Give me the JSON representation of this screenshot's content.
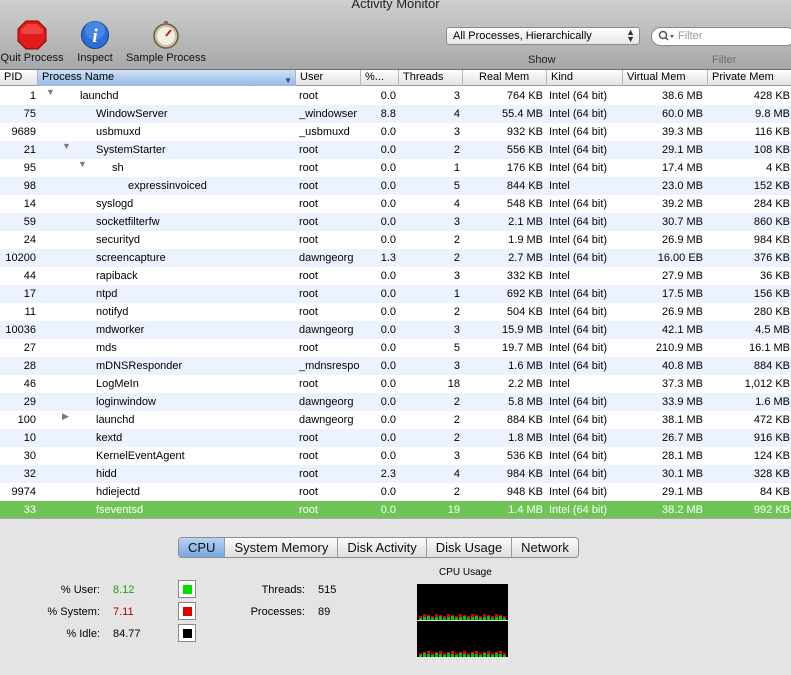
{
  "window": {
    "title": "Activity Monitor"
  },
  "toolbar": {
    "quit_label": "Quit Process",
    "inspect_label": "Inspect",
    "sample_label": "Sample Process",
    "show_value": "All Processes, Hierarchically",
    "show_label": "Show",
    "filter_placeholder": "Filter",
    "filter_label": "Filter"
  },
  "columns": {
    "pid": "PID",
    "name": "Process Name",
    "user": "User",
    "cpu": "%...",
    "threads": "Threads",
    "real_mem": "Real Mem",
    "kind": "Kind",
    "virtual_mem": "Virtual Mem",
    "private_mem": "Private Mem"
  },
  "processes": [
    {
      "pid": "1",
      "name": "launchd",
      "user": "root",
      "cpu": "0.0",
      "threads": "3",
      "real_mem": "764 KB",
      "kind": "Intel (64 bit)",
      "virtual_mem": "38.6 MB",
      "private_mem": "428 KB",
      "depth": 0,
      "toggle": "open"
    },
    {
      "pid": "75",
      "name": "WindowServer",
      "user": "_windowser",
      "cpu": "8.8",
      "threads": "4",
      "real_mem": "55.4 MB",
      "kind": "Intel (64 bit)",
      "virtual_mem": "60.0 MB",
      "private_mem": "9.8 MB",
      "depth": 1,
      "toggle": ""
    },
    {
      "pid": "9689",
      "name": "usbmuxd",
      "user": "_usbmuxd",
      "cpu": "0.0",
      "threads": "3",
      "real_mem": "932 KB",
      "kind": "Intel (64 bit)",
      "virtual_mem": "39.3 MB",
      "private_mem": "116 KB",
      "depth": 1,
      "toggle": ""
    },
    {
      "pid": "21",
      "name": "SystemStarter",
      "user": "root",
      "cpu": "0.0",
      "threads": "2",
      "real_mem": "556 KB",
      "kind": "Intel (64 bit)",
      "virtual_mem": "29.1 MB",
      "private_mem": "108 KB",
      "depth": 1,
      "toggle": "open"
    },
    {
      "pid": "95",
      "name": "sh",
      "user": "root",
      "cpu": "0.0",
      "threads": "1",
      "real_mem": "176 KB",
      "kind": "Intel (64 bit)",
      "virtual_mem": "17.4 MB",
      "private_mem": "4 KB",
      "depth": 2,
      "toggle": "open"
    },
    {
      "pid": "98",
      "name": "expressinvoiced",
      "user": "root",
      "cpu": "0.0",
      "threads": "5",
      "real_mem": "844 KB",
      "kind": "Intel",
      "virtual_mem": "23.0 MB",
      "private_mem": "152 KB",
      "depth": 3,
      "toggle": ""
    },
    {
      "pid": "14",
      "name": "syslogd",
      "user": "root",
      "cpu": "0.0",
      "threads": "4",
      "real_mem": "548 KB",
      "kind": "Intel (64 bit)",
      "virtual_mem": "39.2 MB",
      "private_mem": "284 KB",
      "depth": 1,
      "toggle": ""
    },
    {
      "pid": "59",
      "name": "socketfilterfw",
      "user": "root",
      "cpu": "0.0",
      "threads": "3",
      "real_mem": "2.1 MB",
      "kind": "Intel (64 bit)",
      "virtual_mem": "30.7 MB",
      "private_mem": "860 KB",
      "depth": 1,
      "toggle": ""
    },
    {
      "pid": "24",
      "name": "securityd",
      "user": "root",
      "cpu": "0.0",
      "threads": "2",
      "real_mem": "1.9 MB",
      "kind": "Intel (64 bit)",
      "virtual_mem": "26.9 MB",
      "private_mem": "984 KB",
      "depth": 1,
      "toggle": ""
    },
    {
      "pid": "10200",
      "name": "screencapture",
      "user": "dawngeorg",
      "cpu": "1.3",
      "threads": "2",
      "real_mem": "2.7 MB",
      "kind": "Intel (64 bit)",
      "virtual_mem": "16.00 EB",
      "private_mem": "376 KB",
      "depth": 1,
      "toggle": ""
    },
    {
      "pid": "44",
      "name": "rapiback",
      "user": "root",
      "cpu": "0.0",
      "threads": "3",
      "real_mem": "332 KB",
      "kind": "Intel",
      "virtual_mem": "27.9 MB",
      "private_mem": "36 KB",
      "depth": 1,
      "toggle": ""
    },
    {
      "pid": "17",
      "name": "ntpd",
      "user": "root",
      "cpu": "0.0",
      "threads": "1",
      "real_mem": "692 KB",
      "kind": "Intel (64 bit)",
      "virtual_mem": "17.5 MB",
      "private_mem": "156 KB",
      "depth": 1,
      "toggle": ""
    },
    {
      "pid": "11",
      "name": "notifyd",
      "user": "root",
      "cpu": "0.0",
      "threads": "2",
      "real_mem": "504 KB",
      "kind": "Intel (64 bit)",
      "virtual_mem": "26.9 MB",
      "private_mem": "280 KB",
      "depth": 1,
      "toggle": ""
    },
    {
      "pid": "10036",
      "name": "mdworker",
      "user": "dawngeorg",
      "cpu": "0.0",
      "threads": "3",
      "real_mem": "15.9 MB",
      "kind": "Intel (64 bit)",
      "virtual_mem": "42.1 MB",
      "private_mem": "4.5 MB",
      "depth": 1,
      "toggle": ""
    },
    {
      "pid": "27",
      "name": "mds",
      "user": "root",
      "cpu": "0.0",
      "threads": "5",
      "real_mem": "19.7 MB",
      "kind": "Intel (64 bit)",
      "virtual_mem": "210.9 MB",
      "private_mem": "16.1 MB",
      "depth": 1,
      "toggle": ""
    },
    {
      "pid": "28",
      "name": "mDNSResponder",
      "user": "_mdnsrespo",
      "cpu": "0.0",
      "threads": "3",
      "real_mem": "1.6 MB",
      "kind": "Intel (64 bit)",
      "virtual_mem": "40.8 MB",
      "private_mem": "884 KB",
      "depth": 1,
      "toggle": ""
    },
    {
      "pid": "46",
      "name": "LogMeIn",
      "user": "root",
      "cpu": "0.0",
      "threads": "18",
      "real_mem": "2.2 MB",
      "kind": "Intel",
      "virtual_mem": "37.3 MB",
      "private_mem": "1,012 KB",
      "depth": 1,
      "toggle": ""
    },
    {
      "pid": "29",
      "name": "loginwindow",
      "user": "dawngeorg",
      "cpu": "0.0",
      "threads": "2",
      "real_mem": "5.8 MB",
      "kind": "Intel (64 bit)",
      "virtual_mem": "33.9 MB",
      "private_mem": "1.6 MB",
      "depth": 1,
      "toggle": ""
    },
    {
      "pid": "100",
      "name": "launchd",
      "user": "dawngeorg",
      "cpu": "0.0",
      "threads": "2",
      "real_mem": "884 KB",
      "kind": "Intel (64 bit)",
      "virtual_mem": "38.1 MB",
      "private_mem": "472 KB",
      "depth": 1,
      "toggle": "closed"
    },
    {
      "pid": "10",
      "name": "kextd",
      "user": "root",
      "cpu": "0.0",
      "threads": "2",
      "real_mem": "1.8 MB",
      "kind": "Intel (64 bit)",
      "virtual_mem": "26.7 MB",
      "private_mem": "916 KB",
      "depth": 1,
      "toggle": ""
    },
    {
      "pid": "30",
      "name": "KernelEventAgent",
      "user": "root",
      "cpu": "0.0",
      "threads": "3",
      "real_mem": "536 KB",
      "kind": "Intel (64 bit)",
      "virtual_mem": "28.1 MB",
      "private_mem": "124 KB",
      "depth": 1,
      "toggle": ""
    },
    {
      "pid": "32",
      "name": "hidd",
      "user": "root",
      "cpu": "2.3",
      "threads": "4",
      "real_mem": "984 KB",
      "kind": "Intel (64 bit)",
      "virtual_mem": "30.1 MB",
      "private_mem": "328 KB",
      "depth": 1,
      "toggle": ""
    },
    {
      "pid": "9974",
      "name": "hdiejectd",
      "user": "root",
      "cpu": "0.0",
      "threads": "2",
      "real_mem": "948 KB",
      "kind": "Intel (64 bit)",
      "virtual_mem": "29.1 MB",
      "private_mem": "84 KB",
      "depth": 1,
      "toggle": ""
    },
    {
      "pid": "33",
      "name": "fseventsd",
      "user": "root",
      "cpu": "0.0",
      "threads": "19",
      "real_mem": "1.4 MB",
      "kind": "Intel (64 bit)",
      "virtual_mem": "38.2 MB",
      "private_mem": "992 KB",
      "depth": 1,
      "toggle": "",
      "selected": true
    }
  ],
  "tabs": [
    "CPU",
    "System Memory",
    "Disk Activity",
    "Disk Usage",
    "Network"
  ],
  "cpu_stats": {
    "user_label": "% User:",
    "user_value": "8.12",
    "system_label": "% System:",
    "system_value": "7.11",
    "idle_label": "% Idle:",
    "idle_value": "84.77",
    "threads_label": "Threads:",
    "threads_value": "515",
    "processes_label": "Processes:",
    "processes_value": "89",
    "graph_title": "CPU Usage"
  },
  "colors": {
    "user": "#00c800",
    "system": "#e00000",
    "idle": "#000000",
    "selection": "#6fc456"
  }
}
